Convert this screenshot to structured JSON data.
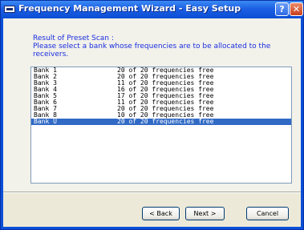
{
  "window": {
    "title": "Frequency Management Wizard - Easy Setup",
    "help_symbol": "?",
    "close_symbol": "✕"
  },
  "header": {
    "line1": "Result of Preset Scan :",
    "line2": "Please select a bank whose frequencies are to be allocated to the",
    "line3": "receivers."
  },
  "banks": [
    {
      "name": "Bank 1",
      "free": "20  of 20 frequencies free"
    },
    {
      "name": "Bank 2",
      "free": "20  of 20 frequencies free"
    },
    {
      "name": "Bank 3",
      "free": "11  of 20 frequencies free"
    },
    {
      "name": "Bank 4",
      "free": "16  of 20 frequencies free"
    },
    {
      "name": "Bank 5",
      "free": "17  of 20 frequencies free"
    },
    {
      "name": "Bank 6",
      "free": "11  of 20 frequencies free"
    },
    {
      "name": "Bank 7",
      "free": "20  of 20 frequencies free"
    },
    {
      "name": "Bank 8",
      "free": "10  of 20 frequencies free"
    },
    {
      "name": "Bank U",
      "free": "20  of 20 frequencies free"
    }
  ],
  "selected_bank_index": 8,
  "buttons": {
    "back": "< Back",
    "next": "Next >",
    "cancel": "Cancel"
  },
  "colors": {
    "selection": "#316ac5",
    "label_text": "#1a2ee0",
    "titlebar": "#0b4ed4"
  }
}
